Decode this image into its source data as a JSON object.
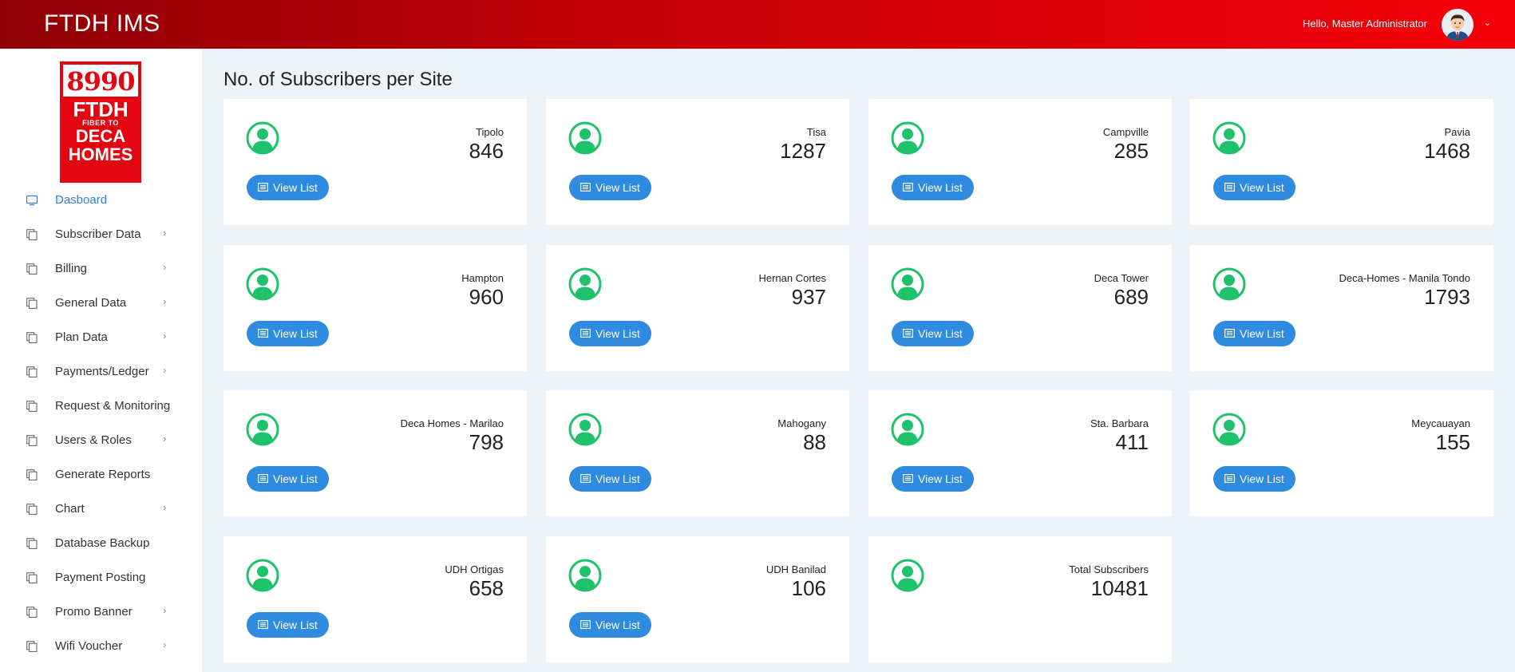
{
  "header": {
    "title": "FTDH IMS",
    "greeting": "Hello, Master Administrator",
    "avatar_icon": "user-avatar-icon",
    "caret": "⌄"
  },
  "logo": {
    "number": "8990",
    "line1": "FTDH",
    "line2": "FIBER TO",
    "line3": "DECA",
    "line4": "HOMES"
  },
  "sidebar": {
    "items": [
      {
        "label": "Dasboard",
        "active": true,
        "chevron": false,
        "icon": "monitor-icon"
      },
      {
        "label": "Subscriber Data",
        "chevron": true,
        "icon": "copy-icon"
      },
      {
        "label": "Billing",
        "chevron": true,
        "icon": "copy-icon"
      },
      {
        "label": "General Data",
        "chevron": true,
        "icon": "copy-icon"
      },
      {
        "label": "Plan Data",
        "chevron": true,
        "icon": "copy-icon"
      },
      {
        "label": "Payments/Ledger",
        "chevron": true,
        "icon": "copy-icon"
      },
      {
        "label": "Request & Monitoring",
        "chevron": true,
        "icon": "copy-icon"
      },
      {
        "label": "Users & Roles",
        "chevron": true,
        "icon": "copy-icon"
      },
      {
        "label": "Generate Reports",
        "chevron": false,
        "icon": "copy-icon"
      },
      {
        "label": "Chart",
        "chevron": true,
        "icon": "copy-icon"
      },
      {
        "label": "Database Backup",
        "chevron": false,
        "icon": "copy-icon"
      },
      {
        "label": "Payment Posting",
        "chevron": false,
        "icon": "copy-icon"
      },
      {
        "label": "Promo Banner",
        "chevron": true,
        "icon": "copy-icon"
      },
      {
        "label": "Wifi Voucher",
        "chevron": true,
        "icon": "copy-icon"
      }
    ]
  },
  "main": {
    "title": "No. of Subscribers per Site",
    "view_label": "View List",
    "accent_color": "#2f8be0",
    "avatar_color": "#1ec26a",
    "sites": [
      {
        "name": "Tipolo",
        "count": "846",
        "button": true
      },
      {
        "name": "Tisa",
        "count": "1287",
        "button": true
      },
      {
        "name": "Campville",
        "count": "285",
        "button": true
      },
      {
        "name": "Pavia",
        "count": "1468",
        "button": true
      },
      {
        "name": "Hampton",
        "count": "960",
        "button": true
      },
      {
        "name": "Hernan Cortes",
        "count": "937",
        "button": true
      },
      {
        "name": "Deca Tower",
        "count": "689",
        "button": true
      },
      {
        "name": "Deca-Homes - Manila Tondo",
        "count": "1793",
        "button": true
      },
      {
        "name": "Deca Homes - Marilao",
        "count": "798",
        "button": true
      },
      {
        "name": "Mahogany",
        "count": "88",
        "button": true
      },
      {
        "name": "Sta. Barbara",
        "count": "411",
        "button": true
      },
      {
        "name": "Meycauayan",
        "count": "155",
        "button": true
      },
      {
        "name": "UDH Ortigas",
        "count": "658",
        "button": true
      },
      {
        "name": "UDH Banilad",
        "count": "106",
        "button": true
      },
      {
        "name": "Total Subscribers",
        "count": "10481",
        "button": false
      }
    ]
  }
}
